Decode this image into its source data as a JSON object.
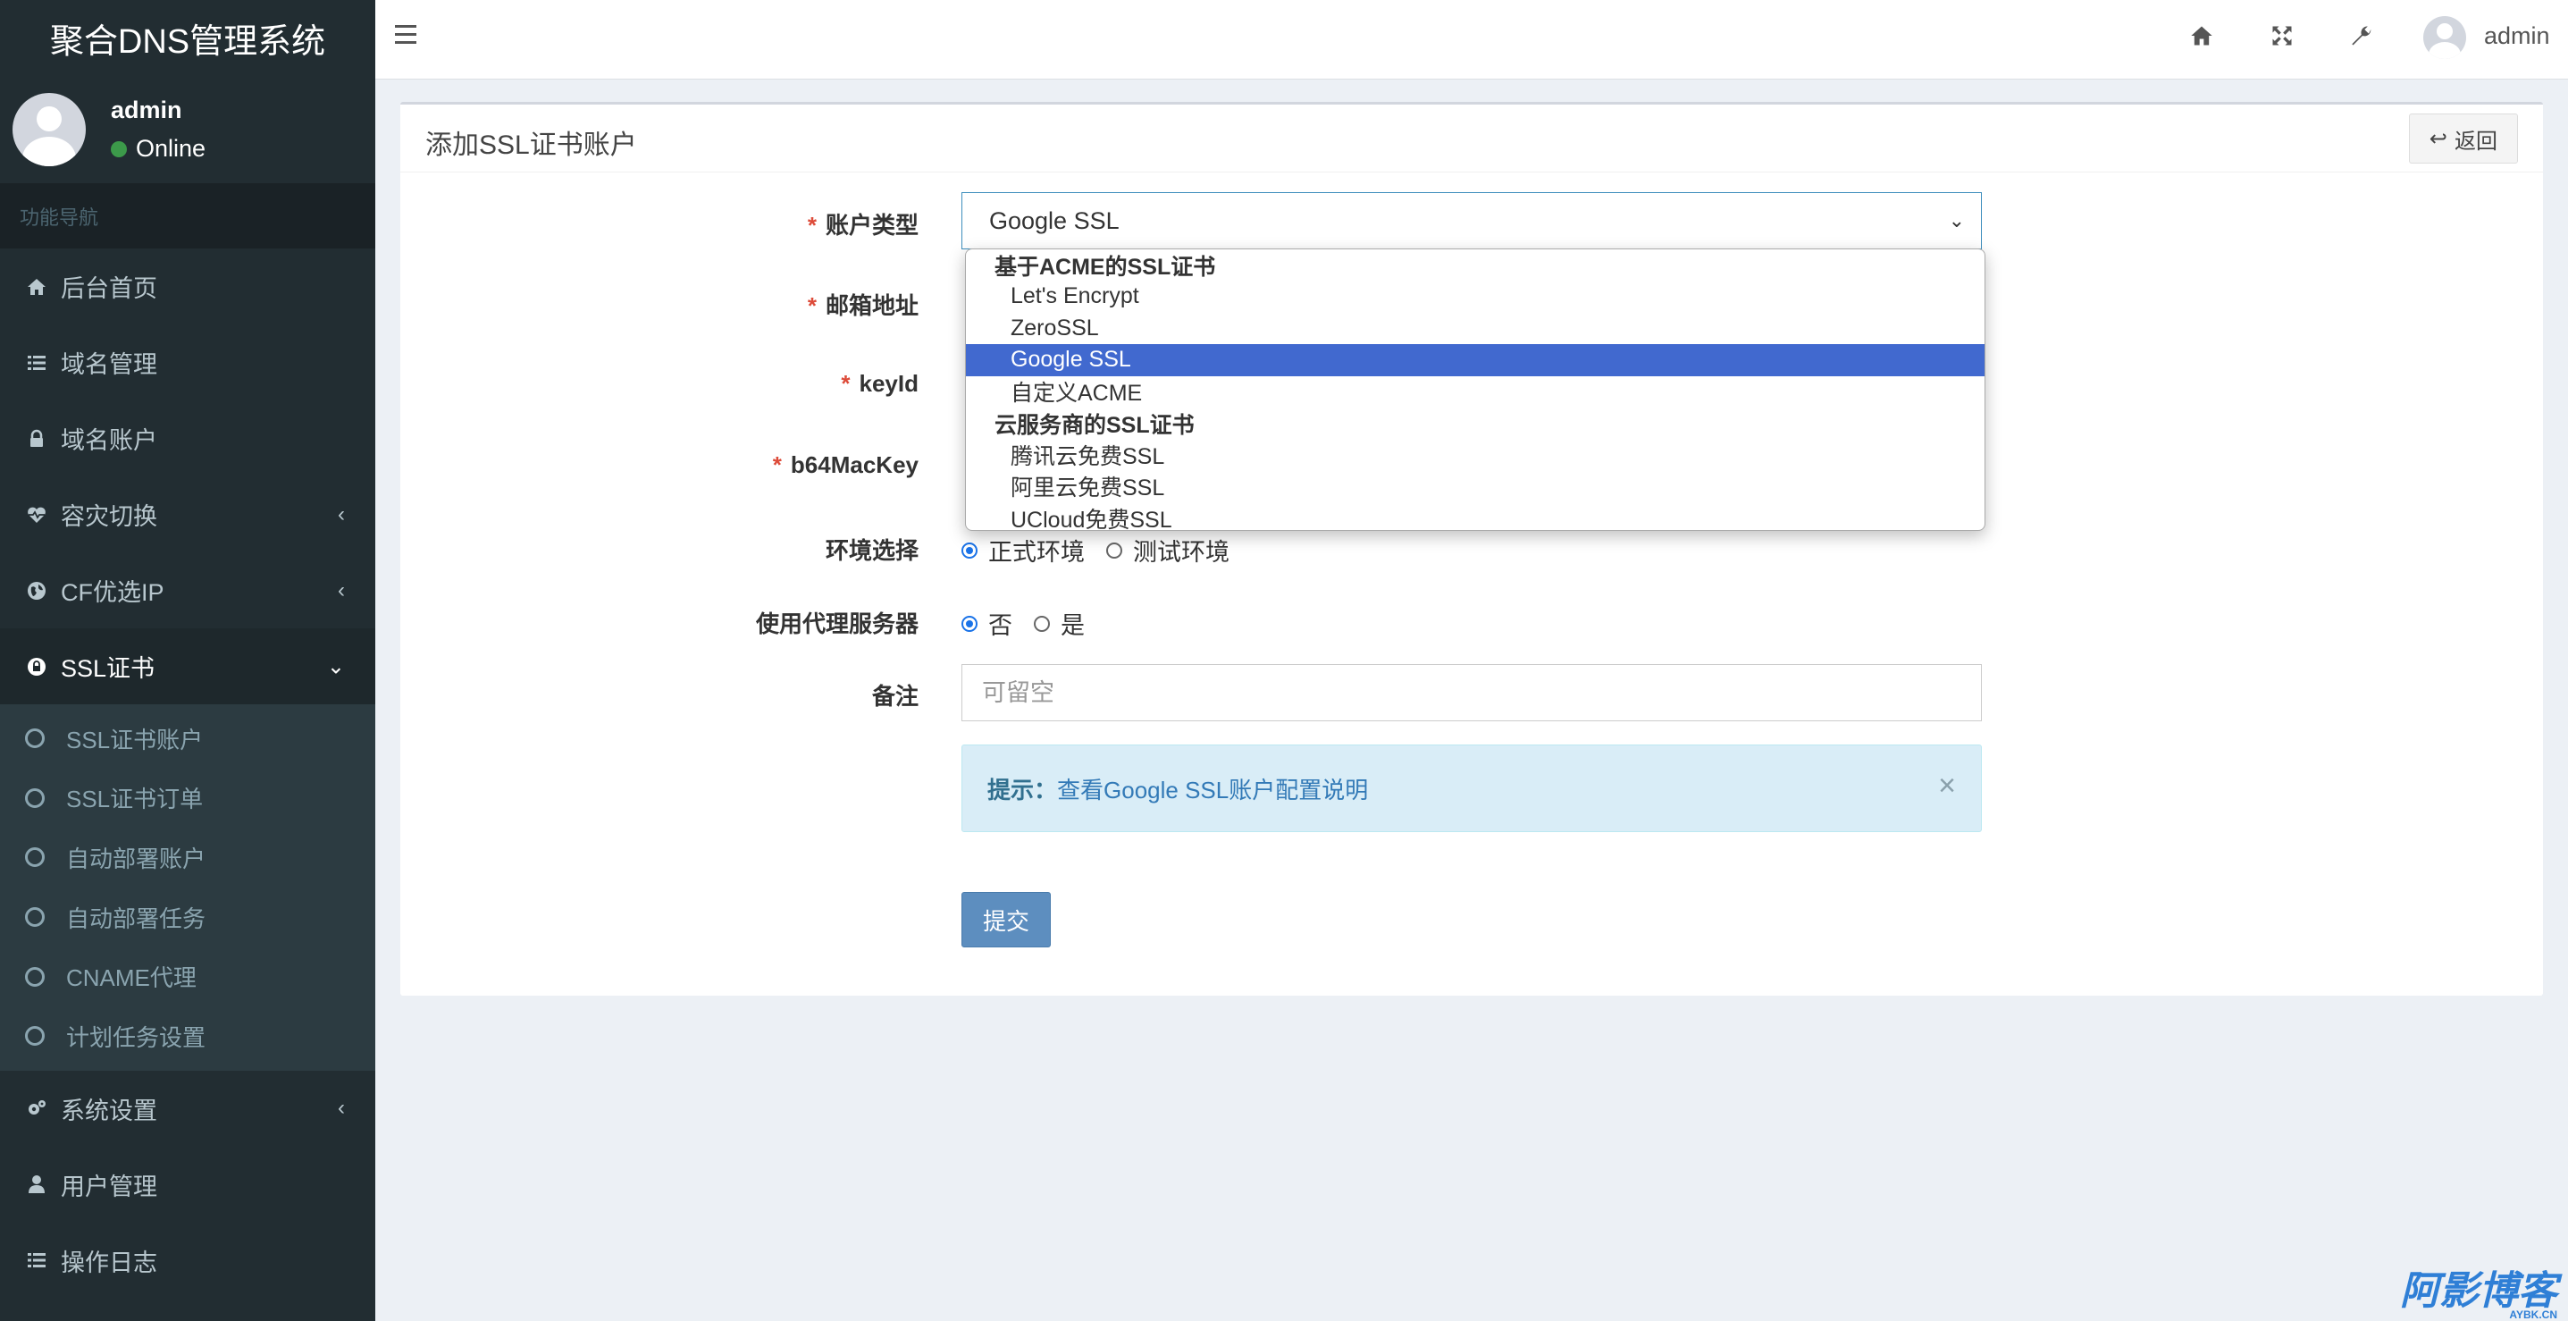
{
  "app": {
    "title": "聚合DNS管理系统"
  },
  "user": {
    "name": "admin",
    "status": "Online"
  },
  "sidebar": {
    "nav_header": "功能导航",
    "items": [
      {
        "label": "后台首页",
        "icon": "home-icon"
      },
      {
        "label": "域名管理",
        "icon": "list-icon"
      },
      {
        "label": "域名账户",
        "icon": "lock-icon"
      },
      {
        "label": "容灾切换",
        "icon": "heartbeat-icon",
        "chevron": "‹"
      },
      {
        "label": "CF优选IP",
        "icon": "globe-icon",
        "chevron": "‹"
      },
      {
        "label": "SSL证书",
        "icon": "ssl-lock-icon",
        "chevron": "⌄",
        "expanded": true
      },
      {
        "label": "系统设置",
        "icon": "gears-icon",
        "chevron": "‹"
      },
      {
        "label": "用户管理",
        "icon": "user-icon"
      },
      {
        "label": "操作日志",
        "icon": "list-icon"
      }
    ],
    "ssl_submenu": [
      "SSL证书账户",
      "SSL证书订单",
      "自动部署账户",
      "自动部署任务",
      "CNAME代理",
      "计划任务设置"
    ]
  },
  "topbar": {
    "user": "admin",
    "icons": [
      "home-icon",
      "fullscreen-icon",
      "wrench-icon"
    ]
  },
  "page": {
    "title": "添加SSL证书账户",
    "back_label": "返回"
  },
  "form": {
    "account_type_label": "账户类型",
    "account_type_value": "Google SSL",
    "email_label": "邮箱地址",
    "keyid_label": "keyId",
    "b64mackey_label": "b64MacKey",
    "env_label": "环境选择",
    "env_options": [
      "正式环境",
      "测试环境"
    ],
    "env_selected": "正式环境",
    "proxy_label": "使用代理服务器",
    "proxy_options": [
      "否",
      "是"
    ],
    "proxy_selected": "否",
    "remark_label": "备注",
    "remark_placeholder": "可留空",
    "tip_prefix": "提示：",
    "tip_link": "查看Google SSL账户配置说明",
    "submit_label": "提交"
  },
  "dropdown": {
    "groups": [
      {
        "label": "基于ACME的SSL证书",
        "options": [
          "Let's Encrypt",
          "ZeroSSL",
          "Google SSL",
          "自定义ACME"
        ]
      },
      {
        "label": "云服务商的SSL证书",
        "options": [
          "腾讯云免费SSL",
          "阿里云免费SSL",
          "UCloud免费SSL"
        ]
      }
    ],
    "selected": "Google SSL"
  },
  "watermark": {
    "text": "阿影博客",
    "sub": "AYBK.CN"
  },
  "colors": {
    "sidebar_bg": "#222d32",
    "accent": "#3c8dbc",
    "selected_option": "#4169cf",
    "required": "#dd4b39"
  }
}
